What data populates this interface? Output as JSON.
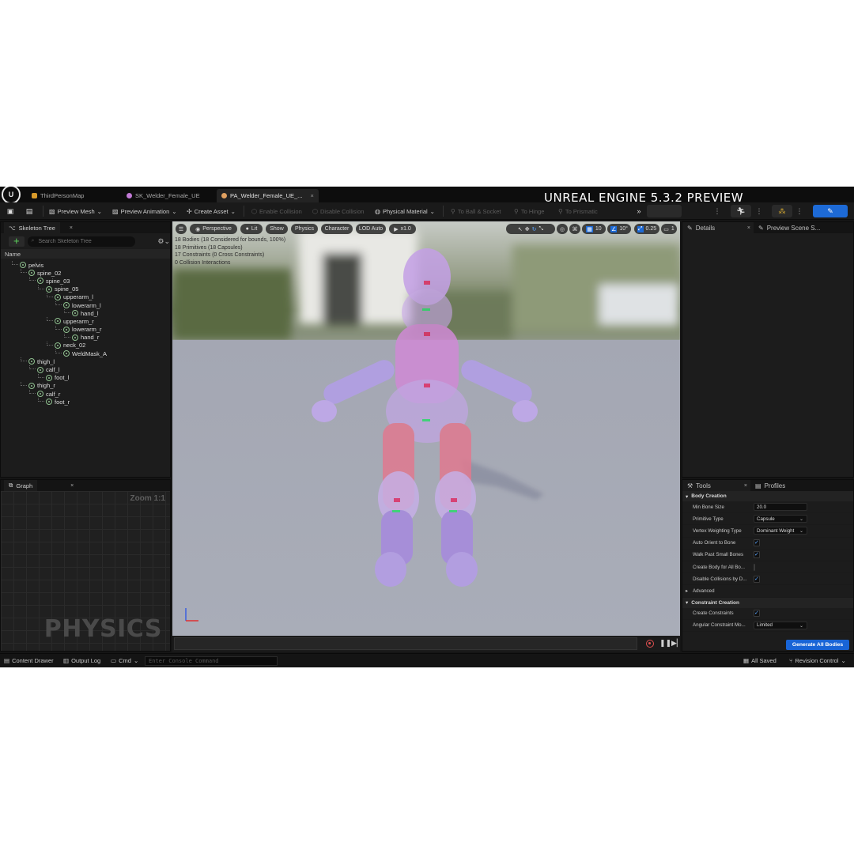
{
  "overlay_title": "UNREAL ENGINE 5.3.2 PREVIEW",
  "tabs": [
    {
      "label": "ThirdPersonMap"
    },
    {
      "label": "SK_Welder_Female_UE"
    },
    {
      "label": "PA_Welder_Female_UE_..."
    }
  ],
  "toolbar": {
    "preview_mesh": "Preview Mesh",
    "preview_animation": "Preview Animation",
    "create_asset": "Create Asset",
    "enable_collision": "Enable Collision",
    "disable_collision": "Disable Collision",
    "physical_material": "Physical Material",
    "to_ball_socket": "To Ball & Socket",
    "to_hinge": "To Hinge",
    "to_prismatic": "To Prismatic"
  },
  "skeleton_tree": {
    "title": "Skeleton Tree",
    "search_placeholder": "Search Skeleton Tree",
    "column_name": "Name",
    "bones": [
      {
        "name": "pelvis"
      },
      {
        "name": "spine_02"
      },
      {
        "name": "spine_03"
      },
      {
        "name": "spine_05"
      },
      {
        "name": "upperarm_l"
      },
      {
        "name": "lowerarm_l"
      },
      {
        "name": "hand_l"
      },
      {
        "name": "upperarm_r"
      },
      {
        "name": "lowerarm_r"
      },
      {
        "name": "hand_r"
      },
      {
        "name": "neck_02"
      },
      {
        "name": "WeldMask_A"
      },
      {
        "name": "thigh_l"
      },
      {
        "name": "calf_l"
      },
      {
        "name": "foot_l"
      },
      {
        "name": "thigh_r"
      },
      {
        "name": "calf_r"
      },
      {
        "name": "foot_r"
      }
    ]
  },
  "graph": {
    "title": "Graph",
    "zoom": "Zoom 1:1",
    "watermark": "PHYSICS"
  },
  "viewport": {
    "perspective": "Perspective",
    "lit": "Lit",
    "show": "Show",
    "physics": "Physics",
    "character": "Character",
    "lod": "LOD Auto",
    "speed": "x1.0",
    "grid_snap": "10",
    "rot_snap": "10°",
    "scale_snap": "0.25",
    "camera_speed": "1",
    "stats": [
      "18 Bodies (18 Considered for bounds, 100%)",
      "18 Primitives (18 Capsules)",
      "17 Constraints (0 Cross Constraints)",
      "0 Collision Interactions"
    ]
  },
  "details": {
    "title": "Details",
    "preview_scene": "Preview Scene S..."
  },
  "tools": {
    "tab_tools": "Tools",
    "tab_profiles": "Profiles",
    "body_creation": "Body Creation",
    "rows": {
      "min_bone_size": {
        "label": "Min Bone Size",
        "value": "20.0"
      },
      "primitive_type": {
        "label": "Primitive Type",
        "value": "Capsule"
      },
      "vertex_weighting": {
        "label": "Vertex Weighting Type",
        "value": "Dominant Weight"
      },
      "auto_orient": {
        "label": "Auto Orient to Bone",
        "checked": true
      },
      "walk_past": {
        "label": "Walk Past Small Bones",
        "checked": true
      },
      "create_body_all": {
        "label": "Create Body for All Bo...",
        "checked": false
      },
      "disable_collisions": {
        "label": "Disable Collisions by D...",
        "checked": true
      }
    },
    "advanced": "Advanced",
    "constraint_creation": "Constraint Creation",
    "create_constraints": {
      "label": "Create Constraints",
      "checked": true
    },
    "angular_constraint": {
      "label": "Angular Constraint Mo...",
      "value": "Limited"
    },
    "generate_button": "Generate All Bodies"
  },
  "statusbar": {
    "content_drawer": "Content Drawer",
    "output_log": "Output Log",
    "cmd": "Cmd",
    "console_placeholder": "Enter Console Command",
    "all_saved": "All Saved",
    "revision_control": "Revision Control"
  },
  "colors": {
    "accent_blue": "#1864d6",
    "panel_bg": "#1c1c1c",
    "ragdoll_tint": "#b58be0"
  }
}
